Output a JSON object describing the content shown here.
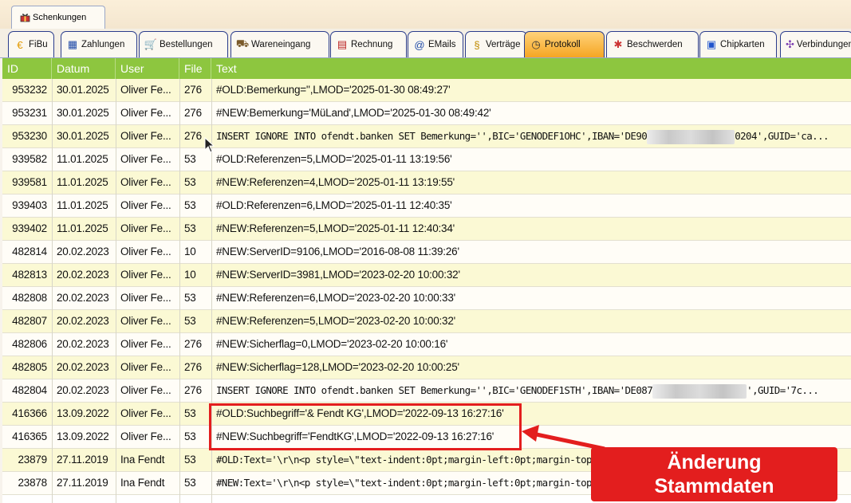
{
  "top_tab": {
    "label": "Schenkungen",
    "icon": "gift-icon"
  },
  "tabs": [
    {
      "label": "FiBu",
      "icon": "euro-coin-icon",
      "active": false
    },
    {
      "label": "Zahlungen",
      "icon": "payments-icon",
      "active": false
    },
    {
      "label": "Bestellungen",
      "icon": "cart-icon",
      "active": false
    },
    {
      "label": "Wareneingang",
      "icon": "delivery-icon",
      "active": false
    },
    {
      "label": "Rechnung",
      "icon": "invoice-icon",
      "active": false
    },
    {
      "label": "EMails",
      "icon": "at-sign-icon",
      "active": false
    },
    {
      "label": "Verträge",
      "icon": "contract-icon",
      "active": false
    },
    {
      "label": "Protokoll",
      "icon": "clock-icon",
      "active": true
    },
    {
      "label": "Beschwerden",
      "icon": "complaint-icon",
      "active": false
    },
    {
      "label": "Chipkarten",
      "icon": "chipcard-icon",
      "active": false
    },
    {
      "label": "Verbindungen",
      "icon": "connections-icon",
      "active": false
    }
  ],
  "table": {
    "headers": {
      "id": "ID",
      "datum": "Datum",
      "user": "User",
      "file": "File",
      "text": "Text"
    },
    "rows": [
      {
        "id": "953232",
        "datum": "30.01.2025",
        "user": "Oliver Fe...",
        "file": "276",
        "text": "#OLD:Bemerkung='',LMOD='2025-01-30  08:49:27'",
        "mono": false
      },
      {
        "id": "953231",
        "datum": "30.01.2025",
        "user": "Oliver Fe...",
        "file": "276",
        "text": "#NEW:Bemerkung='MüLand',LMOD='2025-01-30  08:49:42'",
        "mono": false
      },
      {
        "id": "953230",
        "datum": "30.01.2025",
        "user": "Oliver Fe...",
        "file": "276",
        "text_a": "INSERT IGNORE INTO ofendt.banken SET Bemerkung='',BIC='GENODEF1OHC',IBAN='DE90",
        "text_b": "0204',GUID='ca...",
        "mono": true,
        "redacted": true
      },
      {
        "id": "939582",
        "datum": "11.01.2025",
        "user": "Oliver Fe...",
        "file": "53",
        "text": "#OLD:Referenzen=5,LMOD='2025-01-11  13:19:56'",
        "mono": false
      },
      {
        "id": "939581",
        "datum": "11.01.2025",
        "user": "Oliver Fe...",
        "file": "53",
        "text": "#NEW:Referenzen=4,LMOD='2025-01-11  13:19:55'",
        "mono": false
      },
      {
        "id": "939403",
        "datum": "11.01.2025",
        "user": "Oliver Fe...",
        "file": "53",
        "text": "#OLD:Referenzen=6,LMOD='2025-01-11  12:40:35'",
        "mono": false
      },
      {
        "id": "939402",
        "datum": "11.01.2025",
        "user": "Oliver Fe...",
        "file": "53",
        "text": "#NEW:Referenzen=5,LMOD='2025-01-11  12:40:34'",
        "mono": false
      },
      {
        "id": "482814",
        "datum": "20.02.2023",
        "user": "Oliver Fe...",
        "file": "10",
        "text": "#NEW:ServerID=9106,LMOD='2016-08-08  11:39:26'",
        "mono": false
      },
      {
        "id": "482813",
        "datum": "20.02.2023",
        "user": "Oliver Fe...",
        "file": "10",
        "text": "#NEW:ServerID=3981,LMOD='2023-02-20  10:00:32'",
        "mono": false
      },
      {
        "id": "482808",
        "datum": "20.02.2023",
        "user": "Oliver Fe...",
        "file": "53",
        "text": "#NEW:Referenzen=6,LMOD='2023-02-20  10:00:33'",
        "mono": false
      },
      {
        "id": "482807",
        "datum": "20.02.2023",
        "user": "Oliver Fe...",
        "file": "53",
        "text": "#NEW:Referenzen=5,LMOD='2023-02-20  10:00:32'",
        "mono": false
      },
      {
        "id": "482806",
        "datum": "20.02.2023",
        "user": "Oliver Fe...",
        "file": "276",
        "text": "#NEW:Sicherflag=0,LMOD='2023-02-20  10:00:16'",
        "mono": false
      },
      {
        "id": "482805",
        "datum": "20.02.2023",
        "user": "Oliver Fe...",
        "file": "276",
        "text": "#NEW:Sicherflag=128,LMOD='2023-02-20  10:00:25'",
        "mono": false
      },
      {
        "id": "482804",
        "datum": "20.02.2023",
        "user": "Oliver Fe...",
        "file": "276",
        "text_a": "INSERT IGNORE INTO ofendt.banken SET Bemerkung='',BIC='GENODEF1STH',IBAN='DE087",
        "text_b": "',GUID='7c...",
        "mono": true,
        "redacted": true
      },
      {
        "id": "416366",
        "datum": "13.09.2022",
        "user": "Oliver Fe...",
        "file": "53",
        "text": "#OLD:Suchbegriff='& Fendt  KG',LMOD='2022-09-13  16:27:16'",
        "mono": false
      },
      {
        "id": "416365",
        "datum": "13.09.2022",
        "user": "Oliver Fe...",
        "file": "53",
        "text": "#NEW:Suchbegriff='FendtKG',LMOD='2022-09-13  16:27:16'",
        "mono": false
      },
      {
        "id": "23879",
        "datum": "27.11.2019",
        "user": "Ina Fendt",
        "file": "53",
        "text": "#OLD:Text='\\r\\n<p style=\\\"text-indent:0pt;margin-left:0pt;margin-top:0pt;m",
        "mono": true
      },
      {
        "id": "23878",
        "datum": "27.11.2019",
        "user": "Ina Fendt",
        "file": "53",
        "text": "#NEW:Text='\\r\\n<p style=\\\"text-indent:0pt;margin-left:0pt;margin-top:0pt;m",
        "mono": true
      }
    ]
  },
  "annotation": {
    "line1": "Änderung",
    "line2": "Stammdaten",
    "color": "#e31e1e"
  },
  "colors": {
    "header": "#8dc63f",
    "row_alt": "#fbf9d4",
    "active_tab": "#f5a623"
  }
}
